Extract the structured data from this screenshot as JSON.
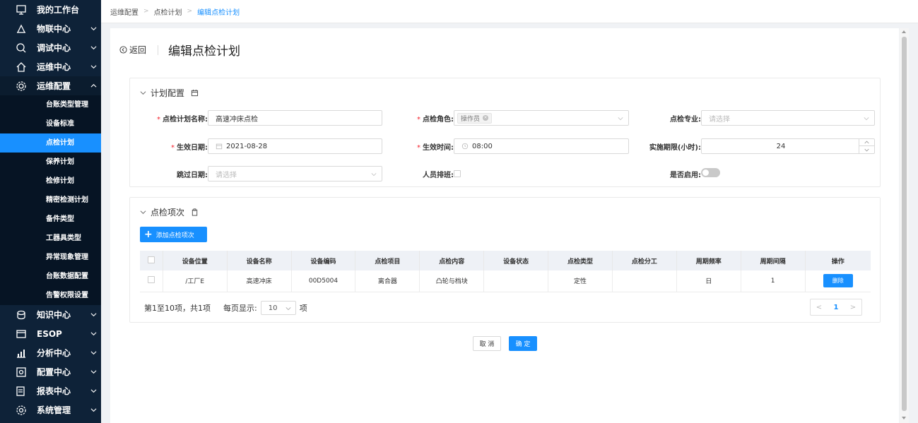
{
  "sidebar": {
    "items": [
      {
        "label": "我的工作台",
        "icon": "workbench-icon"
      },
      {
        "label": "物联中心",
        "icon": "iot-icon"
      },
      {
        "label": "调试中心",
        "icon": "debug-icon"
      },
      {
        "label": "运维中心",
        "icon": "home-icon"
      },
      {
        "label": "运维配置",
        "icon": "gear-icon"
      },
      {
        "label": "知识中心",
        "icon": "knowledge-icon"
      },
      {
        "label": "ESOP",
        "icon": "esop-icon"
      },
      {
        "label": "分析中心",
        "icon": "chart-icon"
      },
      {
        "label": "配置中心",
        "icon": "config-icon"
      },
      {
        "label": "报表中心",
        "icon": "report-icon"
      },
      {
        "label": "系统管理",
        "icon": "settings-icon"
      }
    ],
    "submenu": [
      "台账类型管理",
      "设备标准",
      "点检计划",
      "保养计划",
      "检修计划",
      "精密检测计划",
      "备件类型",
      "工器具类型",
      "异常现象管理",
      "台账数据配置",
      "告警权限设置"
    ],
    "active_submenu": "点检计划"
  },
  "breadcrumb": [
    "运维配置",
    "点检计划",
    "编辑点检计划"
  ],
  "header": {
    "back_label": "返回",
    "title": "编辑点检计划"
  },
  "plan_config": {
    "section_title": "计划配置",
    "name_label": "点检计划名称:",
    "name_value": "高速冲床点检",
    "role_label": "点检角色:",
    "role_tag": "操作员",
    "specialty_label": "点检专业:",
    "specialty_placeholder": "请选择",
    "effective_date_label": "生效日期:",
    "effective_date_value": "2021-08-28",
    "effective_time_label": "生效时间:",
    "effective_time_value": "08:00",
    "period_label": "实施期限(小时):",
    "period_value": "24",
    "skip_date_label": "跳过日期:",
    "skip_date_placeholder": "请选择",
    "staff_schedule_label": "人员排班:",
    "enabled_label": "是否启用:",
    "enabled": false
  },
  "items_section": {
    "section_title": "点检项次",
    "add_label": "添加点检项次",
    "columns": [
      "设备位置",
      "设备名称",
      "设备编码",
      "点检项目",
      "点检内容",
      "设备状态",
      "点检类型",
      "点检分工",
      "周期频率",
      "周期间隔",
      "操作"
    ],
    "rows": [
      {
        "location": "/工厂E",
        "name": "高速冲床",
        "code": "00D5004",
        "item": "离合器",
        "content": "凸轮与档块",
        "status": "",
        "type": "定性",
        "division": "",
        "frequency": "日",
        "interval": "1",
        "action": "删除"
      }
    ],
    "pager_summary": "第1至10项，共1项",
    "page_size_prefix": "每页显示:",
    "page_size": "10",
    "page_size_suffix": "项",
    "current_page": "1"
  },
  "footer": {
    "cancel_label": "取 消",
    "ok_label": "确 定"
  },
  "colors": {
    "sidebar_bg": "#0e2238",
    "accent": "#1890ff"
  }
}
